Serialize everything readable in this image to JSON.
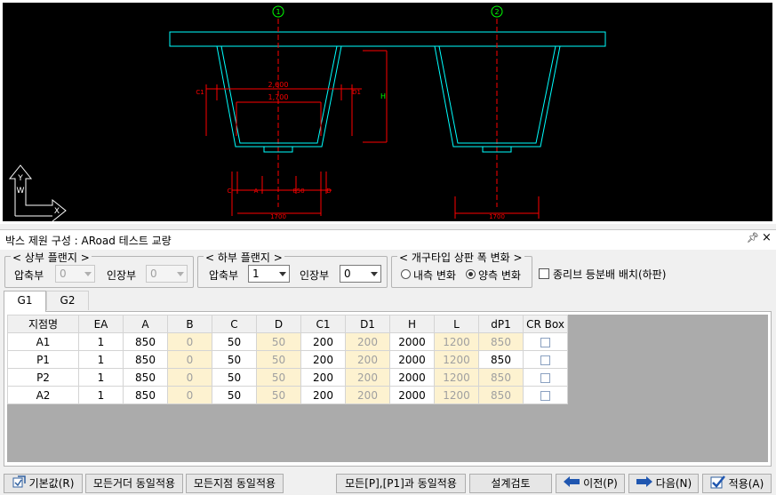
{
  "cad": {
    "bubble_left": "1",
    "bubble_right": "2",
    "dim_2600": "2,600",
    "dim_1700_top": "1,700",
    "dim_c1": "C1",
    "dim_d1_left": "D1",
    "dim_h": "H",
    "bottom_c": "C",
    "bottom_a": "A",
    "bottom_850": "850",
    "bottom_d": "D",
    "bottom_1700_left": "1700",
    "bottom_1700_right": "1700",
    "ucs_y": "Y",
    "ucs_x": "X",
    "ucs_w": "W"
  },
  "panel": {
    "title": "박스 제원 구성 : ARoad 테스트 교량",
    "pin": "ᚹ",
    "close": "×"
  },
  "upper_flange": {
    "legend": "< 상부 플랜지 >",
    "comp_label": "압축부",
    "comp_value": "0",
    "tens_label": "인장부",
    "tens_value": "0"
  },
  "lower_flange": {
    "legend": "< 하부 플랜지 >",
    "comp_label": "압축부",
    "comp_value": "1",
    "tens_label": "인장부",
    "tens_value": "0"
  },
  "open_type": {
    "legend": "< 개구타입 상판 폭 변화 >",
    "inner_label": "내측 변화",
    "both_label": "양측 변화"
  },
  "vertical_rib": {
    "label": "종리브 등분배 배치(하판)"
  },
  "tabs": [
    "G1",
    "G2"
  ],
  "grid": {
    "columns": [
      "지점명",
      "EA",
      "A",
      "B",
      "C",
      "D",
      "C1",
      "D1",
      "H",
      "L",
      "dP1",
      "CR Box"
    ],
    "rows": [
      [
        "A1",
        "1",
        "850",
        "0",
        "50",
        "50",
        "200",
        "200",
        "2000",
        "1200",
        "850"
      ],
      [
        "P1",
        "1",
        "850",
        "0",
        "50",
        "50",
        "200",
        "200",
        "2000",
        "1200",
        "850"
      ],
      [
        "P2",
        "1",
        "850",
        "0",
        "50",
        "50",
        "200",
        "200",
        "2000",
        "1200",
        "850"
      ],
      [
        "A2",
        "1",
        "850",
        "0",
        "50",
        "50",
        "200",
        "200",
        "2000",
        "1200",
        "850"
      ]
    ]
  },
  "buttons": {
    "default": "기본값(R)",
    "all_girder": "모든거더 동일적용",
    "all_support": "모든지점 동일적용",
    "all_p_p1": "모든[P],[P1]과 동일적용",
    "design_check": "설계검토",
    "prev": "이전(P)",
    "next": "다음(N)",
    "apply": "적용(A)"
  },
  "colors": {
    "cad_bg": "#000000",
    "section_line": "#00ffff",
    "dimension": "#ff0000",
    "deck": "#00ffff",
    "bubble": "#00ff00",
    "readonly_cell": "#fdf2d0",
    "grid_bg": "#ababab"
  }
}
